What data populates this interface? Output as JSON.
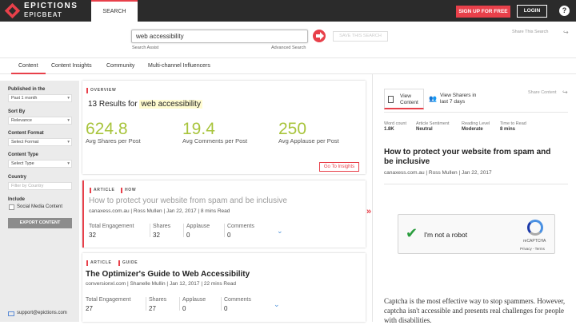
{
  "header": {
    "brand_line1": "EPICTIONS",
    "brand_line2": "EPICBEAT",
    "search_tab": "SEARCH",
    "signup": "SIGN UP FOR FREE",
    "login": "LOGIN",
    "help": "?",
    "accent_color": "#e8404a"
  },
  "search": {
    "value": "web accessibility",
    "search_assist": "Search Assist",
    "advanced_search": "Advanced Search",
    "save_search": "SAVE THIS SEARCH",
    "share_search": "Share This Search"
  },
  "nav": {
    "tabs": [
      "Content",
      "Content Insights",
      "Community",
      "Multi-channel Influencers"
    ],
    "active": "Content"
  },
  "filters": {
    "published_label": "Published in the",
    "published_value": "Past 1 month",
    "sort_label": "Sort By",
    "sort_value": "Relevance",
    "format_label": "Content Format",
    "format_value": "Select Format",
    "type_label": "Content Type",
    "type_value": "Select Type",
    "country_label": "Country",
    "country_placeholder": "Filter by Country",
    "include_label": "Include",
    "social_media_label": "Social Media Content",
    "export": "EXPORT CONTENT",
    "support_email": "support@epictions.com"
  },
  "overview": {
    "tag": "OVERVIEW",
    "results_prefix": "13 Results for",
    "query": "web accessibility",
    "metrics": [
      {
        "value": "624.8",
        "label": "Avg Shares per Post"
      },
      {
        "value": "19.4",
        "label": "Avg Comments per Post"
      },
      {
        "value": "250",
        "label": "Avg Applause per Post"
      }
    ],
    "insights_button": "Go To Insights"
  },
  "articles": [
    {
      "tags": [
        "ARTICLE",
        "HOW"
      ],
      "title": "How to protect your website from spam and be inclusive",
      "source": "canaxess.com.au",
      "author": "Ross Mullen",
      "date": "Jan 22, 2017",
      "read": "8 mins Read",
      "engagement_label": "Total Engagement",
      "engagement": "32",
      "shares_label": "Shares",
      "shares": "32",
      "applause_label": "Applause",
      "applause": "0",
      "comments_label": "Comments",
      "comments": "0"
    },
    {
      "tags": [
        "ARTICLE",
        "GUIDE"
      ],
      "title": "The Optimizer's Guide to Web Accessibility",
      "source": "conversionxl.com",
      "author": "Shanelle Mullin",
      "date": "Jan 12, 2017",
      "read": "22 mins Read",
      "engagement_label": "Total Engagement",
      "engagement": "27",
      "shares_label": "Shares",
      "shares": "27",
      "applause_label": "Applause",
      "applause": "0",
      "comments_label": "Comments",
      "comments": "0"
    }
  ],
  "detail": {
    "tab_view_content": "View Content",
    "tab_view_sharers": "View Sharers in last 7 days",
    "share_content": "Share Content",
    "word_count_label": "Word count",
    "word_count": "1.8K",
    "sentiment_label": "Article Sentiment",
    "sentiment": "Neutral",
    "reading_level_label": "Reading Level",
    "reading_level": "Moderate",
    "time_label": "Time to Read",
    "time": "8 mins",
    "title": "How to protect your website from spam and be inclusive",
    "source": "canaxess.com.au",
    "author": "Ross Mullen",
    "date": "Jan 22, 2017",
    "captcha_text": "I'm not a robot",
    "captcha_brand": "reCAPTCHA",
    "captcha_links": "Privacy - Terms",
    "body": "Captcha is the most effective way to stop spammers. However, captcha isn't accessible and presents real challenges for people with disabilities."
  }
}
